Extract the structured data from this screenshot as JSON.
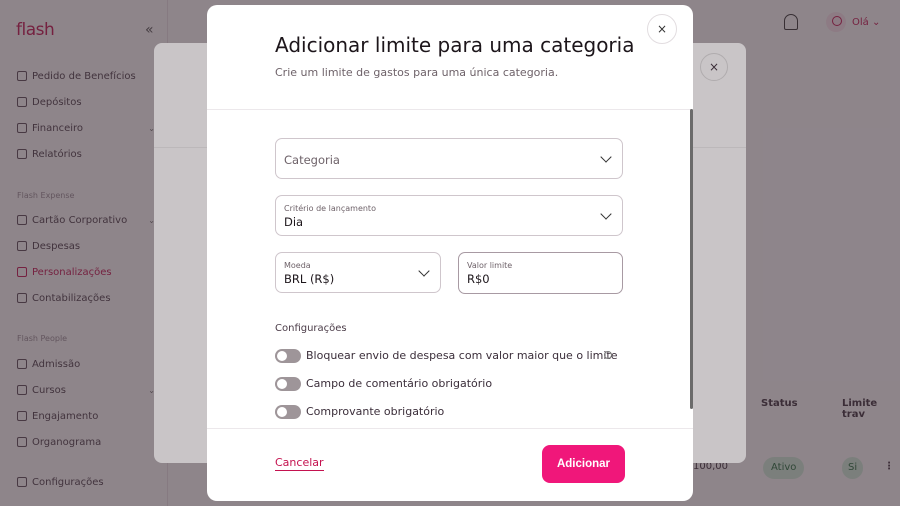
{
  "app": {
    "logo": "flash",
    "collapse_icon": "«",
    "hello": "Olá"
  },
  "sidebar": {
    "items": [
      {
        "label": "Pedido de Benefícios"
      },
      {
        "label": "Depósitos"
      },
      {
        "label": "Financeiro"
      },
      {
        "label": "Relatórios"
      },
      {
        "label": "Cartão Corporativo"
      },
      {
        "label": "Despesas"
      },
      {
        "label": "Personalizações",
        "active": true
      },
      {
        "label": "Contabilizações"
      },
      {
        "label": "Admissão"
      },
      {
        "label": "Cursos"
      },
      {
        "label": "Engajamento"
      },
      {
        "label": "Organograma"
      },
      {
        "label": "Configurações"
      }
    ],
    "sections": [
      "Flash Expense",
      "Flash People"
    ]
  },
  "background_table": {
    "columns": [
      "Status",
      "Limite trav"
    ],
    "row": {
      "amount": "100,00",
      "status": "Ativo",
      "extra": "Si"
    }
  },
  "modal": {
    "title": "Adicionar limite para uma categoria",
    "subtitle": "Crie um limite de gastos para uma única categoria.",
    "close_label": "×",
    "category": {
      "placeholder": "Categoria"
    },
    "criterion": {
      "label": "Critério de lançamento",
      "value": "Dia"
    },
    "currency": {
      "label": "Moeda",
      "value": "BRL (R$)"
    },
    "limit": {
      "label": "Valor limite",
      "value": "R$0"
    },
    "settings_title": "Configurações",
    "toggles": [
      {
        "label": "Bloquear envio de despesa com valor maior que o limite",
        "on": false
      },
      {
        "label": "Campo de comentário obrigatório",
        "on": false
      },
      {
        "label": "Comprovante obrigatório",
        "on": false
      }
    ],
    "cancel_label": "Cancelar",
    "add_label": "Adicionar"
  },
  "colors": {
    "brand": "#c4124f",
    "primary_button": "#f0177a"
  }
}
